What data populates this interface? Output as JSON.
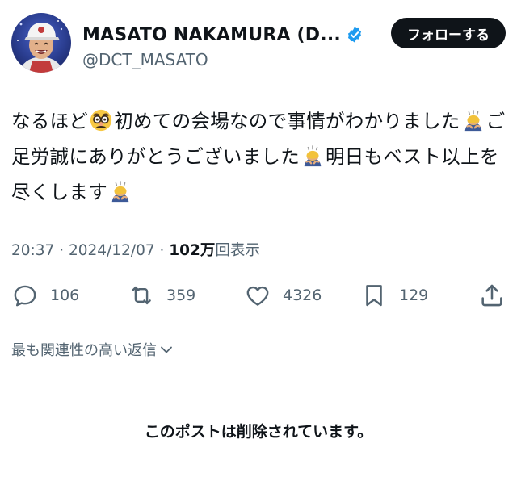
{
  "author": {
    "display_name": "MASATO NAKAMURA (D...",
    "handle": "@DCT_MASATO",
    "verified": true,
    "avatar": "avatar-photo"
  },
  "follow_button": {
    "label": "フォローする"
  },
  "tweet": {
    "segments": [
      {
        "type": "text",
        "value": "なるほど"
      },
      {
        "type": "emoji",
        "name": "disguised-face-emoji"
      },
      {
        "type": "text",
        "value": "初めての会場なので事情がわかりました"
      },
      {
        "type": "emoji",
        "name": "person-bowing-emoji"
      },
      {
        "type": "text",
        "value": "ご足労誠にありがとうございました"
      },
      {
        "type": "emoji",
        "name": "person-bowing-emoji"
      },
      {
        "type": "text",
        "value": "明日もベスト以上を尽くします"
      },
      {
        "type": "emoji",
        "name": "person-bowing-emoji"
      }
    ]
  },
  "meta": {
    "time": "20:37",
    "separator": " · ",
    "date": "2024/12/07",
    "views_count": "102万",
    "views_label": "回表示"
  },
  "actions": {
    "reply": {
      "icon": "reply-icon",
      "count": "106"
    },
    "repost": {
      "icon": "repost-icon",
      "count": "359"
    },
    "like": {
      "icon": "heart-icon",
      "count": "4326"
    },
    "bookmark": {
      "icon": "bookmark-icon",
      "count": "129"
    },
    "share": {
      "icon": "share-icon"
    }
  },
  "replies_sort": {
    "label": "最も関連性の高い返信",
    "icon": "chevron-down-icon"
  },
  "deleted_notice": "このポストは削除されています。",
  "colors": {
    "text_primary": "#0f1419",
    "text_secondary": "#536471",
    "verified_blue": "#1d9bf0",
    "button_bg": "#0f1419",
    "button_text": "#ffffff"
  }
}
